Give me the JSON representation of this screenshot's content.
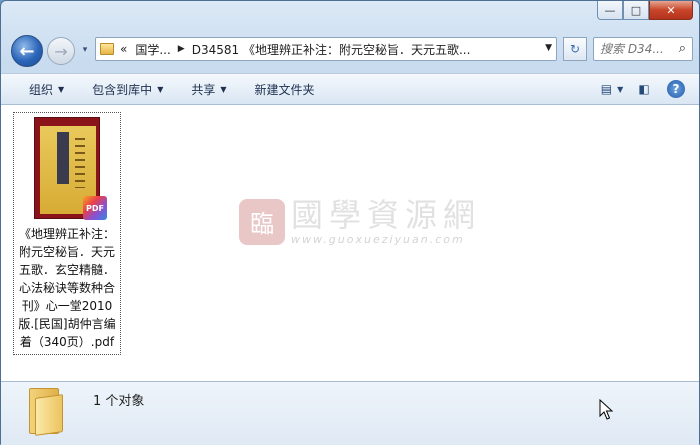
{
  "window": {
    "caption_minimize": "—",
    "caption_maximize": "□",
    "caption_close": "✕"
  },
  "nav": {
    "back_icon": "arrow-left-icon",
    "forward_icon": "arrow-right-icon",
    "history_dropdown": "▾",
    "breadcrumb_overflow": "«",
    "breadcrumbs": [
      "国学...",
      "D34581 《地理辨正补注：附元空秘旨．天元五歌..."
    ],
    "refresh_icon": "↻",
    "search_placeholder": "搜索 D34...",
    "search_icon": "⌕"
  },
  "commands": {
    "organize": "组织",
    "include_in_library": "包含到库中",
    "share": "共享",
    "new_folder": "新建文件夹",
    "views_icon": "▤",
    "preview_pane_icon": "◧",
    "help_icon": "?"
  },
  "files": [
    {
      "name": "《地理辨正补注：附元空秘旨．天元五歌．玄空精髓．心法秘诀等数种合刊》心一堂2010版.[民国]胡仲言编着（340页）.pdf",
      "badge": "PDF"
    }
  ],
  "watermark": {
    "logo_char": "臨",
    "text": "國學資源網",
    "url": "www.guoxueziyuan.com"
  },
  "details": {
    "summary": "1 个对象"
  }
}
